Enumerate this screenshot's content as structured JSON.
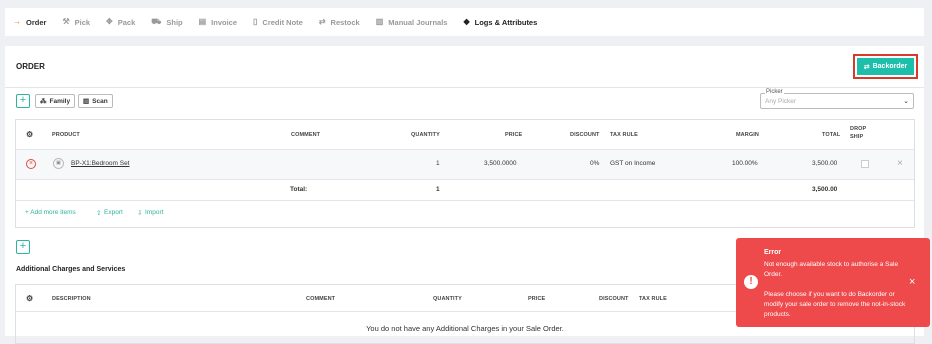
{
  "tabs": [
    {
      "label": "Order",
      "icon": "arrow-right-icon",
      "glyph": "→"
    },
    {
      "label": "Pick",
      "icon": "pick-icon",
      "glyph": "⚒"
    },
    {
      "label": "Pack",
      "icon": "pack-icon",
      "glyph": "✥"
    },
    {
      "label": "Ship",
      "icon": "ship-icon",
      "glyph": "⛟"
    },
    {
      "label": "Invoice",
      "icon": "invoice-icon",
      "glyph": "▤"
    },
    {
      "label": "Credit Note",
      "icon": "credit-note-icon",
      "glyph": "▯"
    },
    {
      "label": "Restock",
      "icon": "restock-icon",
      "glyph": "⇄"
    },
    {
      "label": "Manual Journals",
      "icon": "journal-icon",
      "glyph": "▥"
    },
    {
      "label": "Logs & Attributes",
      "icon": "tag-icon",
      "glyph": "◆"
    }
  ],
  "order": {
    "title": "ORDER",
    "backorder_label": "Backorder",
    "family_label": "Family",
    "scan_label": "Scan",
    "picker": {
      "label": "Picker",
      "placeholder": "Any Picker"
    },
    "columns": {
      "product": "PRODUCT",
      "comment": "COMMENT",
      "quantity": "QUANTITY",
      "price": "PRICE",
      "discount": "DISCOUNT",
      "tax_rule": "TAX RULE",
      "margin": "MARGIN",
      "total": "TOTAL",
      "drop": "DROP",
      "ship": "SHIP"
    },
    "line": {
      "product": "BP-X1:Bedroom Set",
      "quantity": "1",
      "price": "3,500.0000",
      "discount": "0%",
      "tax_rule": "GST on Income",
      "margin": "100.00%",
      "total": "3,500.00"
    },
    "totals": {
      "label": "Total:",
      "quantity": "1",
      "total": "3,500.00"
    },
    "links": {
      "add_more": "+ Add more items",
      "export": "Export",
      "import": "Import"
    }
  },
  "additional": {
    "title": "Additional Charges and Services",
    "columns": {
      "description": "DESCRIPTION",
      "comment": "COMMENT",
      "quantity": "QUANTITY",
      "price": "PRICE",
      "discount": "DISCOUNT",
      "tax_rule": "TAX RULE"
    },
    "empty_message": "You do not have any Additional Charges in your Sale Order."
  },
  "toast": {
    "title": "Error",
    "message": "Not enough available stock to authorise a Sale Order.",
    "message2": "Please choose if you want to do Backorder or modify your sale order to remove the not-in-stock products."
  },
  "colors": {
    "accent": "#2db39e",
    "backorder": "#1ebfaa",
    "highlight": "#d63b2a",
    "error": "#ee4a4c",
    "active_tab": "#e8751a"
  }
}
